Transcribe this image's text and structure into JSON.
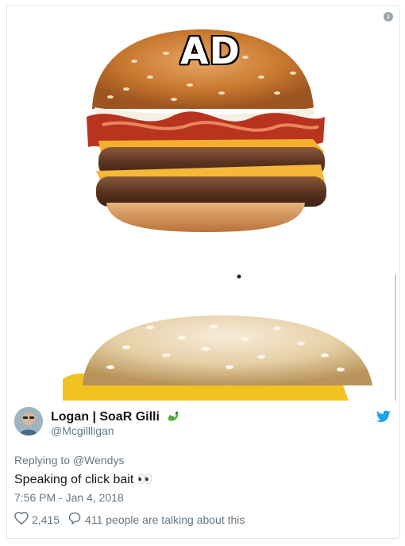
{
  "media": {
    "overlay_text": "AD"
  },
  "tweet": {
    "display_name": "Logan | SoaR Gilli",
    "handle": "@Mcgillligan",
    "replying_prefix": "Replying to",
    "replying_to": "@Wendys",
    "text": "Speaking of click bait",
    "emoji": "👀",
    "timestamp": "7:56 PM - Jan 4, 2018",
    "likes": "2,415",
    "talking": "411 people are talking about this"
  },
  "icons": {
    "info": "info-icon",
    "bird": "twitter-bird-icon",
    "heart": "heart-icon",
    "reply": "reply-bubble-icon",
    "dragon": "dragon-emoji-icon"
  },
  "colors": {
    "twitter_blue": "#1da1f2",
    "secondary_text": "#657786",
    "primary_text": "#14171a"
  }
}
